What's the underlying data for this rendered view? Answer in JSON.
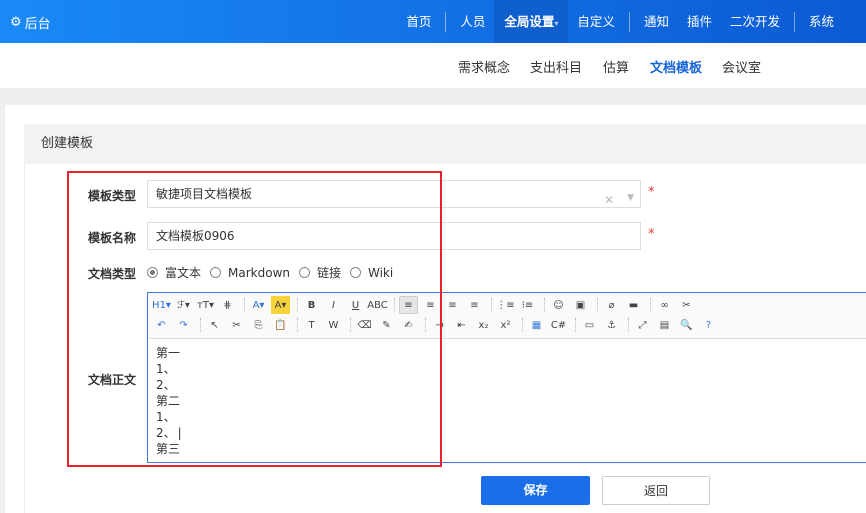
{
  "header": {
    "brand": "后台",
    "nav": [
      {
        "label": "首页"
      },
      {
        "label": "人员"
      },
      {
        "label": "全局设置"
      },
      {
        "label": "自定义"
      },
      {
        "label": "通知"
      },
      {
        "label": "插件"
      },
      {
        "label": "二次开发"
      },
      {
        "label": "系统"
      }
    ]
  },
  "subnav": [
    "需求概念",
    "支出科目",
    "估算",
    "文档模板",
    "会议室"
  ],
  "card": {
    "title": "创建模板"
  },
  "form": {
    "type_label": "模板类型",
    "type_value": "敏捷项目文档模板",
    "name_label": "模板名称",
    "name_value": "文档模板0906",
    "doctype_label": "文档类型",
    "doctype_options": [
      "富文本",
      "Markdown",
      "链接",
      "Wiki"
    ],
    "content_label": "文档正文",
    "content_lines": [
      "第一",
      "1、",
      "2、",
      "第二",
      "1、",
      "2、",
      "第三"
    ],
    "required_mark": "*"
  },
  "toolbar": {
    "row1": [
      "H1▾",
      "ℱ▾",
      "тT▾",
      "⋕",
      "A▾",
      "A▾",
      "B",
      "I",
      "U",
      "ABC",
      "≡",
      "≡",
      "≡",
      "≡",
      "⋮≡",
      "⁝≡",
      "☺",
      "▣",
      "⌀",
      "▬",
      "∞",
      "✂"
    ],
    "row2": [
      "↶",
      "↷",
      "↖",
      "✂",
      "⎘",
      "📋",
      "T",
      "W",
      "⌫",
      "✎",
      "✍",
      "⇥",
      "⇤",
      "x₂",
      "x²",
      "▦",
      "C#",
      "▭",
      "⚓",
      "⤢",
      "▤",
      "🔍",
      "?"
    ]
  },
  "buttons": {
    "save": "保存",
    "back": "返回"
  },
  "colors": {
    "header": "#1a89f6",
    "accent": "#1a6ee8",
    "highlight_box": "#e8202a"
  }
}
